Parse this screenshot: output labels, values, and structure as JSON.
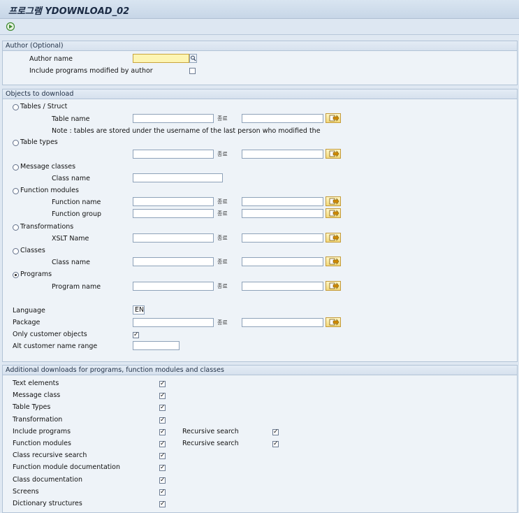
{
  "window": {
    "title": "프로그램 YDOWNLOAD_02"
  },
  "toolbar": {
    "execute_icon": "execute-icon"
  },
  "author": {
    "section_title": "Author (Optional)",
    "author_name_label": "Author name",
    "author_name_value": "",
    "include_modified_label": "Include programs modified by author",
    "include_modified_checked": false
  },
  "objects": {
    "section_title": "Objects to download",
    "to_label": "종료",
    "tables": {
      "radio_label": "Tables / Struct",
      "field_label": "Table name",
      "note": "Note : tables are stored under the username of the last person who modified the"
    },
    "table_types": {
      "radio_label": "Table types"
    },
    "message_classes": {
      "radio_label": "Message classes",
      "field_label": "Class name"
    },
    "function_modules": {
      "radio_label": "Function modules",
      "function_name_label": "Function name",
      "function_group_label": "Function group"
    },
    "transformations": {
      "radio_label": "Transformations",
      "field_label": "XSLT Name"
    },
    "classes": {
      "radio_label": "Classes",
      "field_label": "Class name"
    },
    "programs": {
      "radio_label": "Programs",
      "field_label": "Program name",
      "selected": true
    },
    "language_label": "Language",
    "language_value": "EN",
    "package_label": "Package",
    "only_customer_label": "Only customer objects",
    "only_customer_checked": true,
    "alt_range_label": "Alt customer name range"
  },
  "additional": {
    "section_title": "Additional downloads for programs, function modules and classes",
    "items": [
      {
        "label": "Text elements",
        "checked": true
      },
      {
        "label": "Message class",
        "checked": true
      },
      {
        "label": "Table Types",
        "checked": true
      },
      {
        "label": "Transformation",
        "checked": true
      },
      {
        "label": "Include programs",
        "checked": true,
        "extra_label": "Recursive search",
        "extra_checked": true
      },
      {
        "label": "Function modules",
        "checked": true,
        "extra_label": "Recursive search",
        "extra_checked": true
      },
      {
        "label": "Class recursive search",
        "checked": true
      },
      {
        "label": "Function module documentation",
        "checked": true
      },
      {
        "label": "Class documentation",
        "checked": true
      },
      {
        "label": "Screens",
        "checked": true
      },
      {
        "label": "Dictionary structures",
        "checked": true
      }
    ]
  }
}
